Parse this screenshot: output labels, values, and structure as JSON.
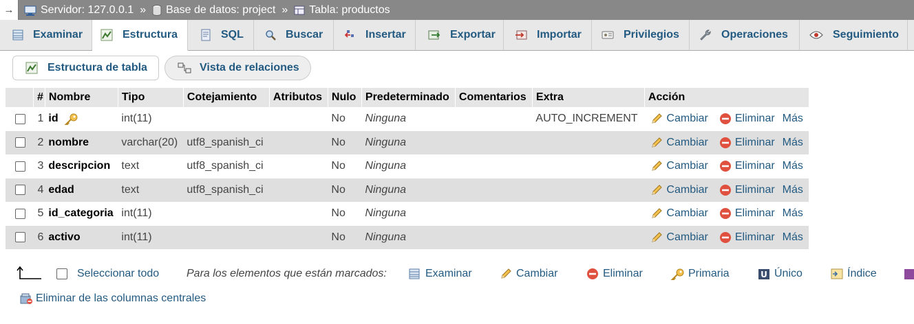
{
  "breadcrumb": {
    "arrow": "→",
    "server": "Servidor: 127.0.0.1",
    "database": "Base de datos: project",
    "table": "Tabla: productos",
    "separator": "»"
  },
  "tabs": [
    {
      "label": "Examinar",
      "icon": "browse-icon"
    },
    {
      "label": "Estructura",
      "icon": "structure-icon",
      "active": true
    },
    {
      "label": "SQL",
      "icon": "sql-icon"
    },
    {
      "label": "Buscar",
      "icon": "search-icon"
    },
    {
      "label": "Insertar",
      "icon": "insert-icon"
    },
    {
      "label": "Exportar",
      "icon": "export-icon"
    },
    {
      "label": "Importar",
      "icon": "import-icon"
    },
    {
      "label": "Privilegios",
      "icon": "privileges-icon"
    },
    {
      "label": "Operaciones",
      "icon": "wrench-icon"
    },
    {
      "label": "Seguimiento",
      "icon": "eye-icon"
    }
  ],
  "subtabs": {
    "table_structure": "Estructura de tabla",
    "relation_view": "Vista de relaciones"
  },
  "columns": {
    "num": "#",
    "name": "Nombre",
    "type": "Tipo",
    "collation": "Cotejamiento",
    "attributes": "Atributos",
    "null": "Nulo",
    "default": "Predeterminado",
    "comments": "Comentarios",
    "extra": "Extra",
    "action": "Acción"
  },
  "rows": [
    {
      "num": "1",
      "name": "id",
      "type": "int(11)",
      "collation": "",
      "null": "No",
      "default": "Ninguna",
      "extra": "AUTO_INCREMENT",
      "primary": true
    },
    {
      "num": "2",
      "name": "nombre",
      "type": "varchar(20)",
      "collation": "utf8_spanish_ci",
      "null": "No",
      "default": "Ninguna",
      "extra": ""
    },
    {
      "num": "3",
      "name": "descripcion",
      "type": "text",
      "collation": "utf8_spanish_ci",
      "null": "No",
      "default": "Ninguna",
      "extra": ""
    },
    {
      "num": "4",
      "name": "edad",
      "type": "text",
      "collation": "utf8_spanish_ci",
      "null": "No",
      "default": "Ninguna",
      "extra": ""
    },
    {
      "num": "5",
      "name": "id_categoria",
      "type": "int(11)",
      "collation": "",
      "null": "No",
      "default": "Ninguna",
      "extra": ""
    },
    {
      "num": "6",
      "name": "activo",
      "type": "int(11)",
      "collation": "",
      "null": "No",
      "default": "Ninguna",
      "extra": ""
    }
  ],
  "row_actions": {
    "change": "Cambiar",
    "drop": "Eliminar",
    "more": "Más"
  },
  "bulk": {
    "select_all": "Seleccionar todo",
    "with_selected": "Para los elementos que están marcados:",
    "browse": "Examinar",
    "change": "Cambiar",
    "drop": "Eliminar",
    "primary": "Primaria",
    "unique": "Único",
    "index": "Índice",
    "remove_central": "Eliminar de las columnas centrales"
  }
}
